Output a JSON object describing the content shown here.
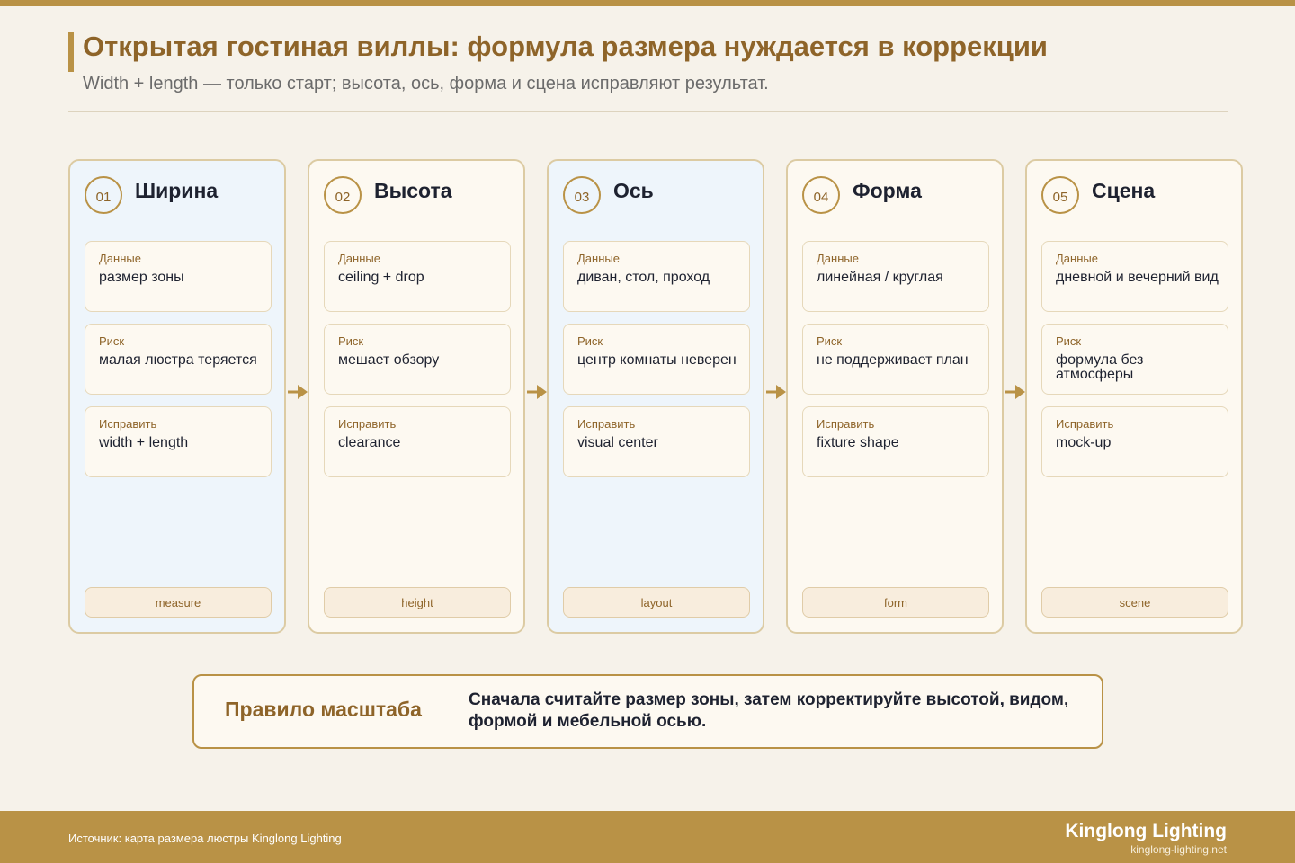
{
  "header": {
    "title": "Открытая гостиная виллы: формула размера нуждается в коррекции",
    "subtitle": "Width + length — только старт; высота, ось, форма и сцена исправляют результат."
  },
  "colors": {
    "accent": "#b99246",
    "title": "#8e6429",
    "card_blue": "#eef5fb",
    "card_cream": "#fdf9f1",
    "background": "#f6f2ea"
  },
  "steps": [
    {
      "num": "01",
      "title": "Ширина",
      "tint": "blue",
      "data_label": "Данные",
      "data_value": "размер зоны",
      "risk_label": "Риск",
      "risk_value": "малая люстра теряется",
      "fix_label": "Исправить",
      "fix_value": "width + length",
      "tag": "measure"
    },
    {
      "num": "02",
      "title": "Высота",
      "tint": "cream",
      "data_label": "Данные",
      "data_value": "ceiling + drop",
      "risk_label": "Риск",
      "risk_value": "мешает обзору",
      "fix_label": "Исправить",
      "fix_value": "clearance",
      "tag": "height"
    },
    {
      "num": "03",
      "title": "Ось",
      "tint": "blue",
      "data_label": "Данные",
      "data_value": "диван, стол, проход",
      "risk_label": "Риск",
      "risk_value": "центр комнаты неверен",
      "fix_label": "Исправить",
      "fix_value": "visual center",
      "tag": "layout"
    },
    {
      "num": "04",
      "title": "Форма",
      "tint": "cream",
      "data_label": "Данные",
      "data_value": "линейная / круглая",
      "risk_label": "Риск",
      "risk_value": "не поддерживает план",
      "fix_label": "Исправить",
      "fix_value": "fixture shape",
      "tag": "form"
    },
    {
      "num": "05",
      "title": "Сцена",
      "tint": "cream",
      "data_label": "Данные",
      "data_value": "дневной и вечерний вид",
      "risk_label": "Риск",
      "risk_value": "формула без атмосферы",
      "fix_label": "Исправить",
      "fix_value": "mock-up",
      "tag": "scene"
    }
  ],
  "rule": {
    "title": "Правило масштаба",
    "text": "Сначала считайте размер зоны, затем корректируйте высотой, видом, формой и мебельной осью."
  },
  "footer": {
    "source": "Источник: карта размера люстры Kinglong Lighting",
    "brand": "Kinglong Lighting",
    "site": "kinglong-lighting.net"
  }
}
